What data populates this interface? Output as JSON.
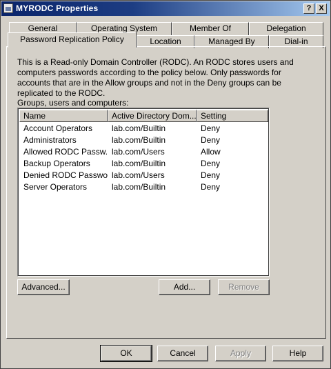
{
  "window": {
    "title": "MYRODC Properties"
  },
  "titlebar_buttons": {
    "help": "?",
    "close": "X"
  },
  "tabs_row1": [
    "General",
    "Operating System",
    "Member Of",
    "Delegation"
  ],
  "tabs_row2": [
    "Password Replication Policy",
    "Location",
    "Managed By",
    "Dial-in"
  ],
  "active_tab": "Password Replication Policy",
  "panel": {
    "description": "This is a Read-only Domain Controller (RODC).  An RODC stores users and computers passwords according to the policy below.  Only passwords for accounts that are in the Allow groups and not in the Deny groups can be replicated to the RODC.",
    "groups_label": "Groups, users and computers:",
    "columns": [
      "Name",
      "Active Directory Dom...",
      "Setting"
    ],
    "rows": [
      [
        "Account Operators",
        "lab.com/Builtin",
        "Deny"
      ],
      [
        "Administrators",
        "lab.com/Builtin",
        "Deny"
      ],
      [
        "Allowed RODC Passw...",
        "lab.com/Users",
        "Allow"
      ],
      [
        "Backup Operators",
        "lab.com/Builtin",
        "Deny"
      ],
      [
        "Denied RODC Passwo...",
        "lab.com/Users",
        "Deny"
      ],
      [
        "Server Operators",
        "lab.com/Builtin",
        "Deny"
      ]
    ],
    "buttons": {
      "advanced": "Advanced...",
      "add": "Add...",
      "remove": "Remove"
    }
  },
  "footer_buttons": {
    "ok": "OK",
    "cancel": "Cancel",
    "apply": "Apply",
    "help": "Help"
  }
}
